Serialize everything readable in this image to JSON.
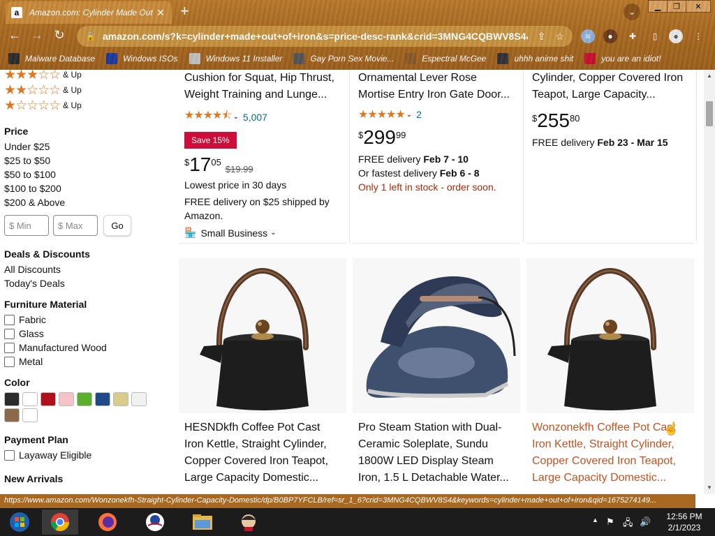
{
  "browser": {
    "tab": {
      "favicon": "a",
      "title": "Amazon.com: Cylinder Made Out",
      "close_icon": "✕"
    },
    "new_tab_icon": "+",
    "url": "amazon.com/s?k=cylinder+made+out+of+iron&s=price-desc-rank&crid=3MNG4CQBWV8S4&...",
    "bookmarks": [
      {
        "label": "Malware Database",
        "icon": "skull-icon",
        "color": "#2d2d2d"
      },
      {
        "label": "Windows ISOs",
        "icon": "x-icon",
        "color": "#1b3a9a"
      },
      {
        "label": "Windows 11 Installer",
        "icon": "installer-icon",
        "color": "#c0c0c0"
      },
      {
        "label": "Gay Porn Sex Movie...",
        "icon": "bear-icon",
        "color": "#555555"
      },
      {
        "label": "Espectral McGee",
        "icon": "ghost-icon",
        "color": "#8a5a2a"
      },
      {
        "label": "uhhh anime shit",
        "icon": "anime-icon",
        "color": "#333333"
      },
      {
        "label": "you are an idiot!",
        "icon": "flag-icon",
        "color": "#c8102e"
      }
    ]
  },
  "sidebar": {
    "star_filters": [
      {
        "stars": "★★★☆☆",
        "label": "& Up"
      },
      {
        "stars": "★★☆☆☆",
        "label": "& Up"
      },
      {
        "stars": "★☆☆☆☆",
        "label": "& Up"
      }
    ],
    "price": {
      "heading": "Price",
      "ranges": [
        "Under $25",
        "$25 to $50",
        "$50 to $100",
        "$100 to $200",
        "$200 & Above"
      ],
      "min_placeholder": "$ Min",
      "max_placeholder": "$ Max",
      "go_label": "Go"
    },
    "deals": {
      "heading": "Deals & Discounts",
      "links": [
        "All Discounts",
        "Today's Deals"
      ]
    },
    "material": {
      "heading": "Furniture Material",
      "options": [
        "Fabric",
        "Glass",
        "Manufactured Wood",
        "Metal"
      ]
    },
    "color": {
      "heading": "Color",
      "swatches": [
        "#2b2b2b",
        "#ffffff",
        "#b0101c",
        "#f4c2c8",
        "#5ab02a",
        "#1f4a8a",
        "#d9cc8a",
        "#f1f1f1",
        "#8a6a4a",
        "#ffffff"
      ]
    },
    "payment": {
      "heading": "Payment Plan",
      "options": [
        "Layaway Eligible"
      ]
    },
    "new_arrivals": {
      "heading": "New Arrivals"
    }
  },
  "products_top": [
    {
      "title_lines": [
        "Cushion for Squat, Hip Thrust,",
        "Weight Training and Lunge..."
      ],
      "stars": "★★★★⯪",
      "rating_count": "5,007",
      "badge": "Save 15%",
      "price_whole": "17",
      "price_frac": "05",
      "list_price": "$19.99",
      "notes": [
        "Lowest price in 30 days",
        "FREE delivery on $25 shipped by",
        "Amazon."
      ],
      "small_business": "Small Business"
    },
    {
      "title_lines": [
        "Ornamental Lever Rose",
        "Mortise Entry Iron Gate Door..."
      ],
      "stars": "★★★★★",
      "rating_count": "2",
      "price_whole": "299",
      "price_frac": "99",
      "delivery_prefix": "FREE delivery ",
      "delivery_date": "Feb 7 - 10",
      "fastest_prefix": "Or fastest delivery ",
      "fastest_date": "Feb 6 - 8",
      "stock": "Only 1 left in stock - order soon."
    },
    {
      "title_lines": [
        "Cylinder, Copper Covered Iron",
        "Teapot, Large Capacity..."
      ],
      "price_whole": "255",
      "price_frac": "80",
      "delivery_prefix": "FREE delivery ",
      "delivery_date": "Feb 23 - Mar 15"
    }
  ],
  "products_bottom": [
    {
      "image": "teapot-image",
      "title_lines": [
        "HESNDkfh Coffee Pot Cast",
        "Iron Kettle, Straight Cylinder,",
        "Copper Covered Iron Teapot,",
        "Large Capacity Domestic..."
      ]
    },
    {
      "image": "steam-iron-image",
      "title_lines": [
        "Pro Steam Station with Dual-",
        "Ceramic Soleplate, Sundu",
        "1800W LED Display Steam",
        "Iron, 1.5 L Detachable Water..."
      ]
    },
    {
      "image": "teapot-image",
      "title_lines": [
        "Wonzonekfh Coffee Pot Cast",
        "Iron Kettle, Straight Cylinder,",
        "Copper Covered Iron Teapot,",
        "Large Capacity Domestic..."
      ]
    }
  ],
  "status_url": "https://www.amazon.com/Wonzonekfh-Straight-Cylinder-Capacity-Domestic/dp/B0BP7YFCLB/ref=sr_1_6?crid=3MNG4CQBWV8S4&keywords=cylinder+made+out+of+iron&qid=1675274149...",
  "clock": {
    "time": "12:56 PM",
    "date": "2/1/2023"
  }
}
